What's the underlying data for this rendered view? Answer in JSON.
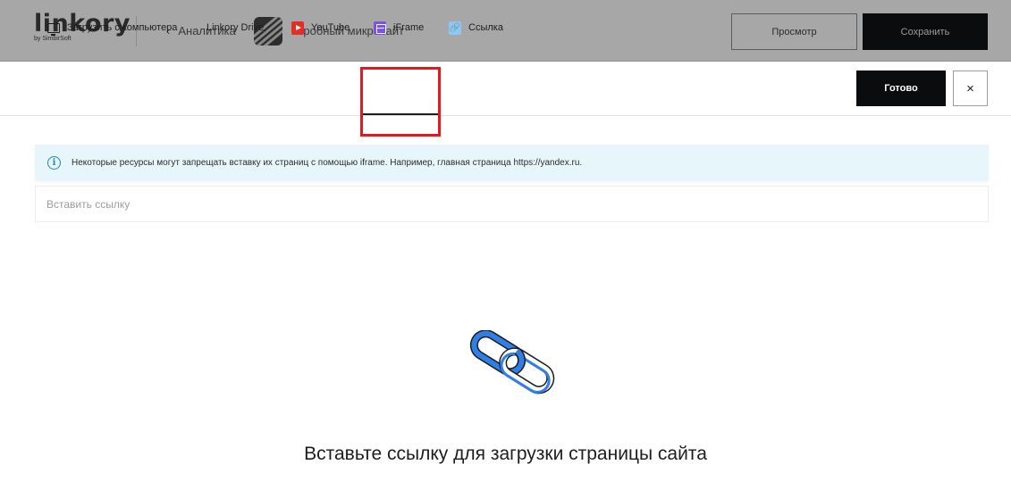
{
  "header": {
    "logo_text": "linkory",
    "logo_sub": "by SimbirSoft",
    "back_label": "Аналитика",
    "site_name": "Пробный микросайт",
    "preview_label": "Просмотр",
    "save_label": "Сохранить"
  },
  "tabs": [
    {
      "label": "Загрузить с компьютера",
      "icon": "monitor-icon"
    },
    {
      "label": "Linkory Drive",
      "icon": ""
    },
    {
      "label": "YouTube",
      "icon": "youtube-icon"
    },
    {
      "label": "iFrame",
      "icon": "iframe-icon",
      "active": true
    },
    {
      "label": "Ссылка",
      "icon": "link-icon"
    }
  ],
  "actions": {
    "done_label": "Готово",
    "close_label": "×"
  },
  "info": {
    "text": "Некоторые ресурсы могут запрещать вставку их страниц с помощью iframe. Например, главная страница https://yandex.ru."
  },
  "input": {
    "placeholder": "Вставить ссылку",
    "value": ""
  },
  "empty_state": {
    "caption": "Вставьте ссылку для загрузки страницы сайта"
  },
  "colors": {
    "accent": "#0b0c0e",
    "highlight": "#e3191f",
    "info_bg": "#e6f6fa",
    "chain_blue": "#2f7fe6"
  }
}
